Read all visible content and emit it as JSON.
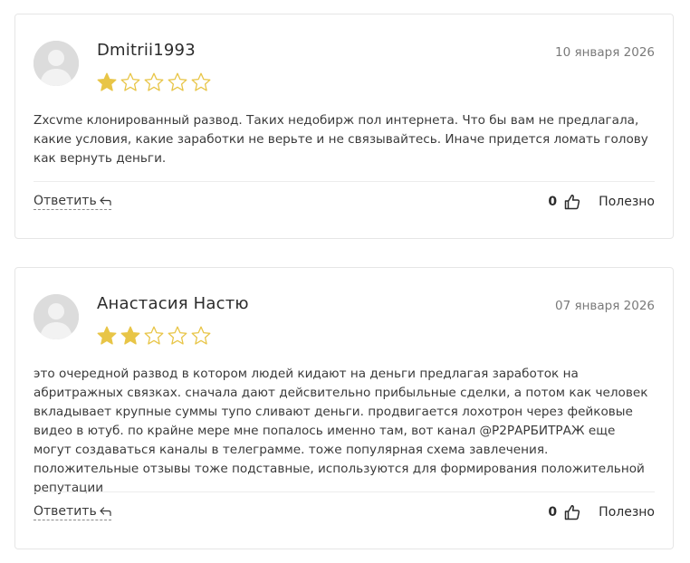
{
  "colors": {
    "star_filled": "#E8C547",
    "star_empty_stroke": "#E8C547",
    "text": "#2B2B2B",
    "muted": "#7A7A7A",
    "border": "#E6E6E6",
    "avatar_bg": "#DCDCDC"
  },
  "reviews": [
    {
      "author": "Dmitrii1993",
      "date": "10 января 2026",
      "rating": 1,
      "rating_max": 5,
      "text": "Zxcvme клонированный развод. Таких недобирж пол интернета. Что бы вам не предлагала, какие условия, какие заработки не верьте и не связывайтесь. Иначе придется ломать голову как вернуть деньги.",
      "reply_label": "Ответить",
      "reply_icon": "reply-arrow-icon",
      "helpful_count": "0",
      "helpful_icon": "thumbs-up-icon",
      "helpful_label": "Полезно"
    },
    {
      "author": "Анастасия Настю",
      "date": "07 января 2026",
      "rating": 2,
      "rating_max": 5,
      "text": "это очередной развод в котором людей кидают на деньги предлагая заработок на абритражных связках. сначала дают дейсвительно прибыльные сделки, а потом как человек вкладывает крупные суммы тупо сливают деньги. продвигается лохотрон через фейковые видео в ютуб. по крайне мере мне попалось именно там, вот канал @P2PАРБИТРАЖ еще могут создаваться каналы в телеграмме. тоже популярная схема завлечения. положительные отзывы тоже подставные, используются для формирования положительной репутации",
      "reply_label": "Ответить",
      "reply_icon": "reply-arrow-icon",
      "helpful_count": "0",
      "helpful_icon": "thumbs-up-icon",
      "helpful_label": "Полезно"
    }
  ]
}
